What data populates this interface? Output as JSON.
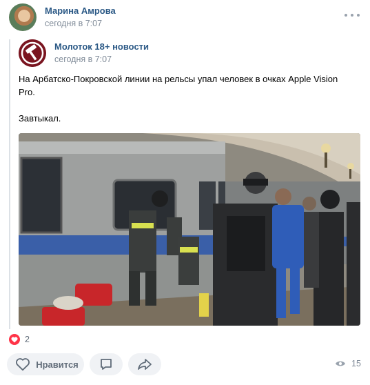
{
  "post": {
    "author": {
      "name": "Марина Амрова",
      "time": "сегодня в 7:07"
    },
    "repost": {
      "source": {
        "name": "Молоток 18+ новости",
        "time": "сегодня в 7:07"
      },
      "text_line1": "На Арбатско-Покровской линии на рельсы упал человек в очках Apple Vision Pro.",
      "text_line2": "Завтыкал."
    },
    "photo_alt": "rescue-workers-at-metro-train-photo"
  },
  "reactions": {
    "likes_count": "2"
  },
  "actions": {
    "like_label": "Нравится",
    "views_count": "15"
  },
  "colors": {
    "link": "#2a5885",
    "secondary": "#818c99",
    "heart": "#ff3347",
    "button_bg": "#f0f2f5"
  },
  "icons": [
    "more-icon",
    "hammer-logo-icon",
    "heart-icon",
    "comment-icon",
    "share-icon",
    "eye-icon"
  ]
}
